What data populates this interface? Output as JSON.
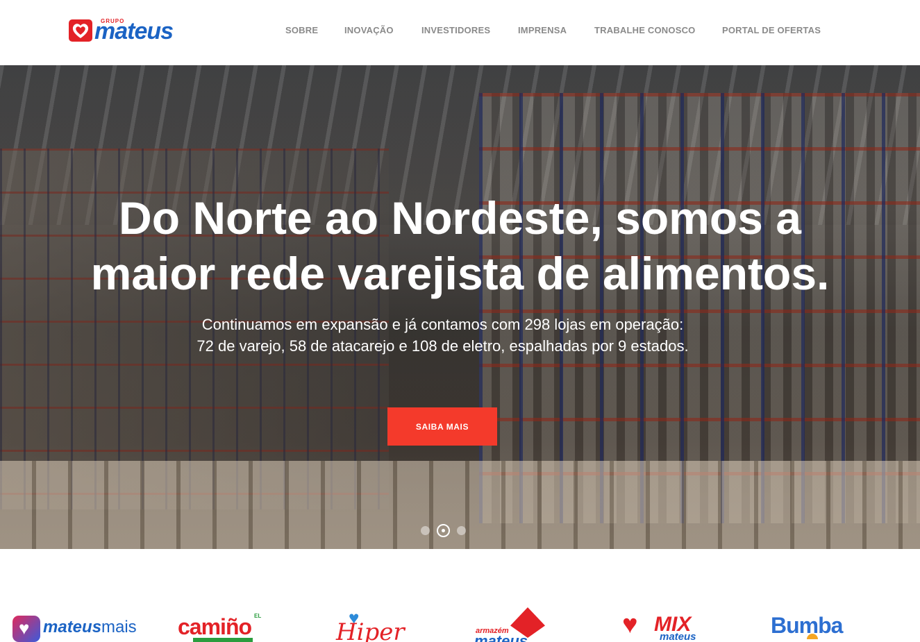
{
  "header": {
    "logo": {
      "small": "GRUPO",
      "word": "mateus"
    },
    "nav": [
      "SOBRE",
      "INOVAÇÃO",
      "INVESTIDORES",
      "IMPRENSA",
      "TRABALHE CONOSCO",
      "PORTAL DE OFERTAS"
    ]
  },
  "hero": {
    "title_line1": "Do Norte ao Nordeste, somos a",
    "title_line2": "maior rede varejista de alimentos.",
    "subtitle_line1": "Continuamos em expansão e já contamos com 298 lojas em operação:",
    "subtitle_line2": "72 de varejo, 58 de atacarejo e 108 de eletro, espalhadas por 9 estados.",
    "cta": "SAIBA MAIS",
    "slides": 3,
    "active_slide": 2
  },
  "brands": {
    "mateus_mais": {
      "part1": "mateus",
      "part2": "mais"
    },
    "camino": {
      "main": "camiño",
      "prefix": "EL"
    },
    "hiper": {
      "main": "Hiper"
    },
    "armazem": {
      "top": "armazém",
      "main": "mateus"
    },
    "mix": {
      "top": "MIX",
      "main": "mateus"
    },
    "bumba": {
      "main": "Bumba"
    }
  },
  "colors": {
    "brand_red": "#e32227",
    "brand_blue": "#1b63c4",
    "cta": "#f43a2b",
    "nav_text": "#8a8a8a"
  },
  "icons": [
    "heart-logo-icon",
    "slider-dot-icon"
  ]
}
